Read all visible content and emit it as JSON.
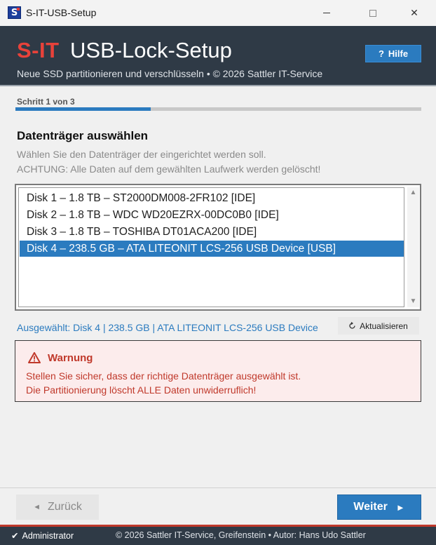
{
  "window": {
    "title": "S-IT-USB-Setup",
    "icon_letter": "S",
    "minimize_symbol": "",
    "close_symbol": "✕"
  },
  "header": {
    "brand": "S-IT",
    "app_name": "USB-Lock-Setup",
    "subtitle": "Neue SSD partitionieren und verschlüsseln  •  © 2026 Sattler IT-Service",
    "help_icon": "?",
    "help_label": "Hilfe"
  },
  "progress": {
    "step_label": "Schritt 1 von 3",
    "current_step": 1,
    "total_steps": 3
  },
  "section": {
    "title": "Datenträger auswählen",
    "desc_line1": "Wählen Sie den Datenträger der eingerichtet werden soll.",
    "desc_line2": "ACHTUNG: Alle Daten auf dem gewählten Laufwerk werden gelöscht!"
  },
  "disks": [
    {
      "label": "Disk 1  –  1.8 TB  –  ST2000DM008-2FR102  [IDE]",
      "selected": false
    },
    {
      "label": "Disk 2  –  1.8 TB  –  WDC WD20EZRX-00DC0B0  [IDE]",
      "selected": false
    },
    {
      "label": "Disk 3  –  1.8 TB  –  TOSHIBA DT01ACA200  [IDE]",
      "selected": false
    },
    {
      "label": "Disk 4  –  238.5 GB  –  ATA LITEONIT LCS-256 USB Device  [USB]",
      "selected": true
    }
  ],
  "selection": {
    "info": "Ausgewählt: Disk 4  |  238.5 GB  |  ATA LITEONIT LCS-256 USB Device",
    "refresh_label": "Aktualisieren"
  },
  "warning": {
    "title": "Warnung",
    "line1": "Stellen Sie sicher, dass der richtige Datenträger ausgewählt ist.",
    "line2": "Die Partitionierung löscht ALLE Daten unwiderruflich!"
  },
  "footer": {
    "back_label": "Zurück",
    "next_label": "Weiter"
  },
  "status": {
    "user_role": "Administrator",
    "copyright": "© 2026 Sattler IT-Service, Greifenstein  •  Autor: Hans Udo Sattler"
  },
  "colors": {
    "accent": "#2b7bbf",
    "brand_red": "#e8423a",
    "header_bg": "#2f3a46",
    "warning_bg": "#fcecec",
    "warning_text": "#c0392b"
  }
}
